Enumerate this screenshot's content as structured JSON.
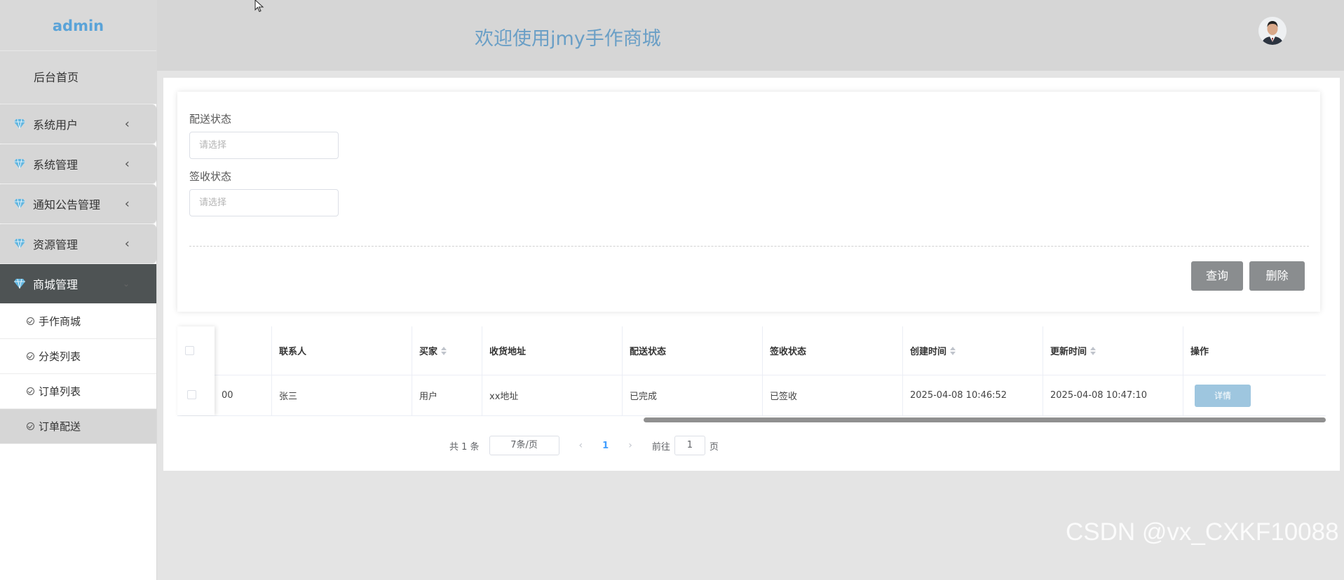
{
  "sidebar": {
    "logo": "admin",
    "home": "后台首页",
    "menus": [
      {
        "label": "系统用户"
      },
      {
        "label": "系统管理"
      },
      {
        "label": "通知公告管理"
      },
      {
        "label": "资源管理"
      },
      {
        "label": "商城管理"
      }
    ],
    "subitems": [
      "手作商城",
      "分类列表",
      "订单列表",
      "订单配送"
    ]
  },
  "header": {
    "title": "欢迎使用jmy手作商城"
  },
  "filters": {
    "delivery_label": "配送状态",
    "delivery_placeholder": "请选择",
    "receipt_label": "签收状态",
    "receipt_placeholder": "请选择",
    "query_button": "查询",
    "delete_button": "删除"
  },
  "table": {
    "columns": [
      "联系人",
      "买家",
      "收货地址",
      "配送状态",
      "签收状态",
      "创建时间",
      "更新时间",
      "操作"
    ],
    "rows": [
      {
        "partial_id": "00",
        "contact": "张三",
        "buyer": "用户",
        "address": "xx地址",
        "delivery_status": "已完成",
        "receipt_status": "已签收",
        "created": "2025-04-08 10:46:52",
        "updated": "2025-04-08 10:47:10",
        "action": "详情"
      }
    ]
  },
  "pagination": {
    "total": "共 1 条",
    "page_size": "7条/页",
    "current_page": "1",
    "goto_label": "前往",
    "goto_value": "1",
    "page_suffix": "页"
  },
  "watermark": "CSDN @vx_CXKF10088",
  "colors": {
    "accent": "#6a9fc6",
    "active_menu": "#4e5354",
    "button": "#8a8d8f"
  }
}
